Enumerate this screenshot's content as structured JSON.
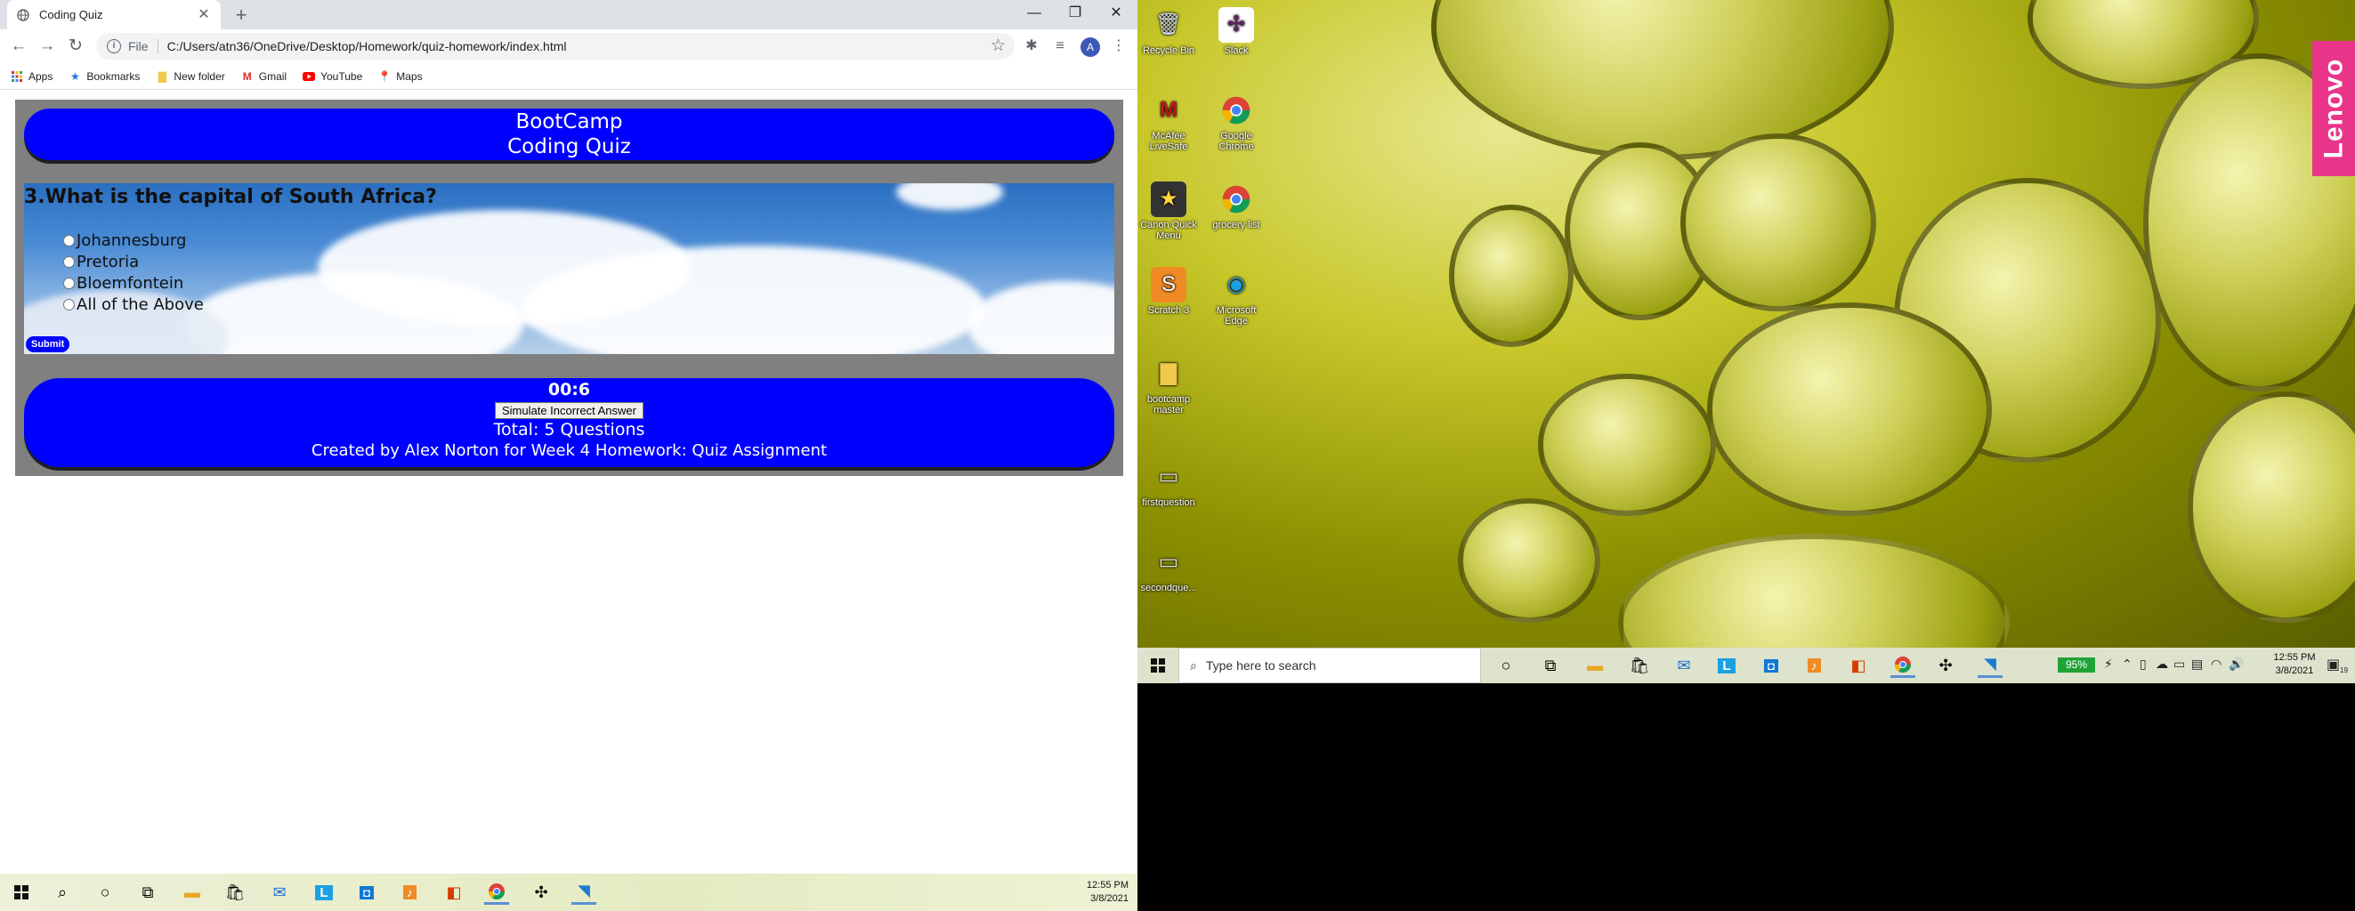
{
  "browser": {
    "tab_title": "Coding Quiz",
    "scheme_label": "File",
    "url": "C:/Users/atn36/OneDrive/Desktop/Homework/quiz-homework/index.html",
    "avatar_letter": "A",
    "bookmarks": [
      "Apps",
      "Bookmarks",
      "New folder",
      "Gmail",
      "YouTube",
      "Maps"
    ]
  },
  "quiz": {
    "header_line1": "BootCamp",
    "header_line2": "Coding Quiz",
    "question": "3.What is the capital of South Africa?",
    "answers": [
      "Johannesburg",
      "Pretoria",
      "Bloemfontein",
      "All of the Above"
    ],
    "submit_label": "Submit",
    "timer": "00:6",
    "simulate_label": "Simulate Incorrect Answer",
    "total": "Total: 5 Questions",
    "credit": "Created by Alex Norton for Week 4 Homework: Quiz Assignment"
  },
  "left_taskbar": {
    "time": "12:55 PM",
    "date": "3/8/2021"
  },
  "desktop": {
    "brand": "Lenovo",
    "icons": [
      "Recycle Bin",
      "Slack",
      "McAfee LiveSafe",
      "Google Chrome",
      "Canon Quick Menu",
      "grocery list",
      "Scratch 3",
      "Microsoft Edge",
      "bootcamp master",
      "firstquestion",
      "secondque..."
    ]
  },
  "right_taskbar": {
    "search_placeholder": "Type here to search",
    "battery": "95%",
    "time": "12:55 PM",
    "date": "3/8/2021",
    "notification_count": "19"
  },
  "colors": {
    "pill_blue": "#0000ff",
    "quiz_bg": "#808080",
    "battery_green": "#1fa337",
    "lenovo_pink": "#e8358a"
  }
}
